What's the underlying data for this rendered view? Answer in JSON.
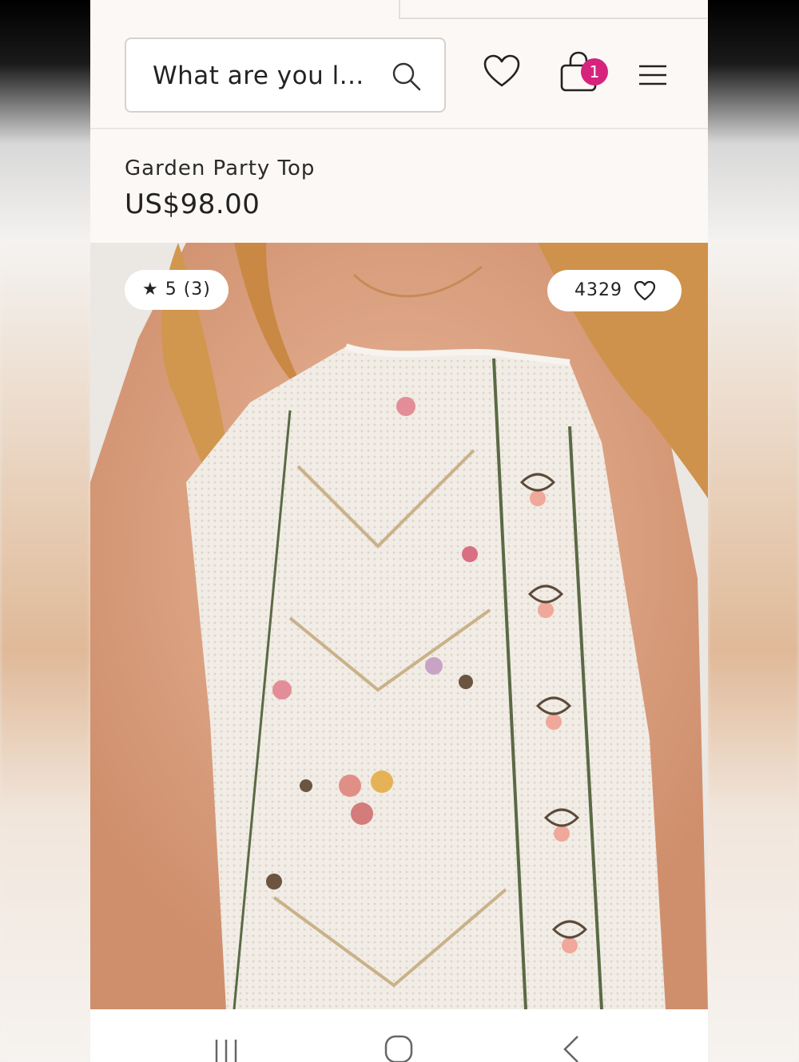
{
  "search": {
    "placeholder": "What are you l..."
  },
  "header": {
    "cart_count": "1"
  },
  "product": {
    "title": "Garden Party Top",
    "price": "US$98.00",
    "rating_text": "★ 5 (3)",
    "likes_count": "4329"
  },
  "colors": {
    "badge": "#d6247d",
    "background": "#fcf8f5"
  },
  "icons": {
    "search": "search-icon",
    "wishlist": "heart-icon",
    "cart": "shopping-bag-icon",
    "menu": "hamburger-menu-icon",
    "likes": "heart-outline-icon",
    "nav_recent": "recent-apps-icon",
    "nav_home": "home-icon",
    "nav_back": "back-icon"
  }
}
